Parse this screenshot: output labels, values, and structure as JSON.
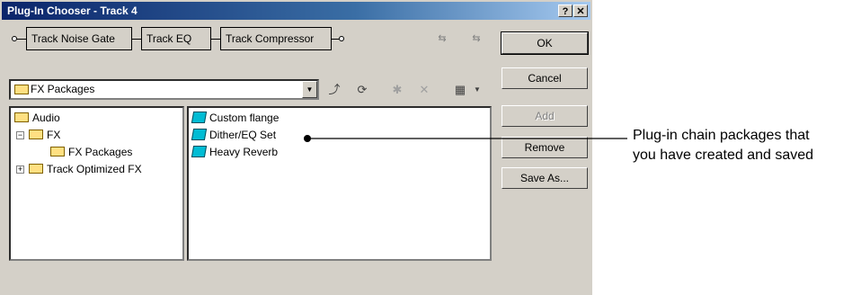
{
  "window": {
    "title": "Plug-In Chooser - Track 4",
    "help_btn": "?",
    "close_btn": "✕"
  },
  "chain": {
    "slots": [
      "Track Noise Gate",
      "Track EQ",
      "Track Compressor"
    ]
  },
  "buttons": {
    "ok": "OK",
    "cancel": "Cancel",
    "add": "Add",
    "remove": "Remove",
    "save_as": "Save As..."
  },
  "location": {
    "value": "FX Packages"
  },
  "tree": {
    "items": [
      {
        "label": "Audio"
      },
      {
        "label": "FX"
      },
      {
        "label": "FX Packages"
      },
      {
        "label": "Track Optimized FX"
      }
    ]
  },
  "packages": {
    "items": [
      "Custom flange",
      "Dither/EQ Set",
      "Heavy Reverb"
    ]
  },
  "callout": {
    "line1": "Plug-in chain packages that",
    "line2": "you have created and saved"
  },
  "colors": {
    "titlebar": "#0a246a",
    "face": "#d4d0c8",
    "folder": "#ffe082",
    "package": "#00bcd4"
  }
}
